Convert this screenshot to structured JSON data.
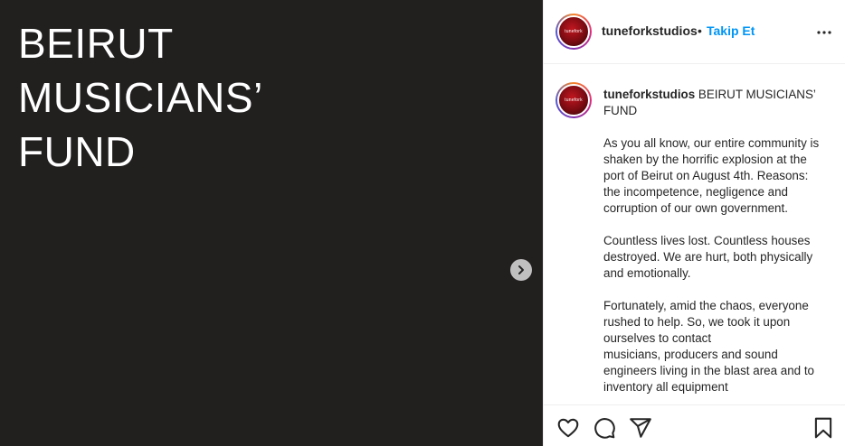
{
  "post": {
    "image_title": "BEIRUT\nMUSICIANS’\nFUND"
  },
  "header": {
    "avatar_text": "tunefork",
    "username": "tuneforkstudios",
    "separator": "•",
    "follow_label": "Takip Et"
  },
  "caption": {
    "username": "tuneforkstudios",
    "title": "BEIRUT MUSICIANS’ FUND",
    "paragraphs": [
      "As you all know, our entire community is shaken by the horrific explosion at the port of Beirut on August 4th. Reasons: the incompetence, negligence and corruption of our own government.",
      "Countless lives lost. Countless houses destroyed. We are hurt, both physically and emotionally.",
      "Fortunately, amid the chaos, everyone rushed to help. So, we took it upon ourselves to contact",
      "musicians, producers and sound engineers living in the blast area and to inventory all equipment"
    ]
  },
  "colors": {
    "image_background": "#221f1f",
    "link_blue": "#0095f6",
    "text": "#262626",
    "border": "#efefef"
  },
  "icons": {
    "next": "chevron-right-icon",
    "more": "more-horizontal-icon",
    "like": "heart-icon",
    "comment": "comment-icon",
    "share": "share-icon",
    "save": "bookmark-icon"
  }
}
